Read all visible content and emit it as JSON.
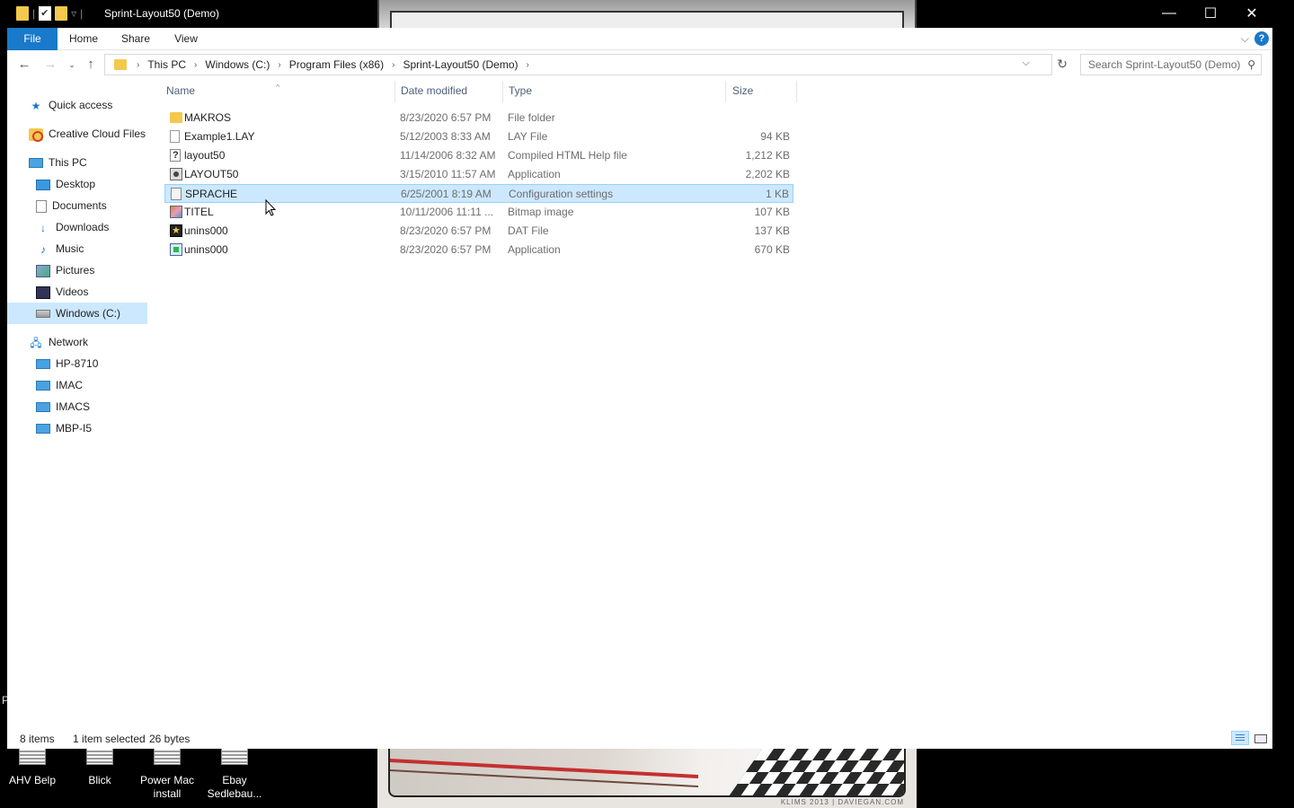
{
  "window": {
    "title": "Sprint-Layout50 (Demo)",
    "minimize": "—",
    "maximize": "☐",
    "close": "✕"
  },
  "ribbon": {
    "tabs": [
      "File",
      "Home",
      "Share",
      "View"
    ],
    "help": "?"
  },
  "address": {
    "crumbs": [
      "This PC",
      "Windows (C:)",
      "Program Files (x86)",
      "Sprint-Layout50 (Demo)"
    ],
    "search_placeholder": "Search Sprint-Layout50 (Demo)"
  },
  "sidebar": {
    "items": [
      {
        "label": "Quick access",
        "icon": "star-icon"
      },
      {
        "label": "Creative Cloud Files",
        "icon": "creative-cloud-icon"
      },
      {
        "label": "This PC",
        "icon": "computer-icon"
      },
      {
        "label": "Desktop",
        "icon": "desktop-icon"
      },
      {
        "label": "Documents",
        "icon": "documents-icon"
      },
      {
        "label": "Downloads",
        "icon": "downloads-icon"
      },
      {
        "label": "Music",
        "icon": "music-icon"
      },
      {
        "label": "Pictures",
        "icon": "pictures-icon"
      },
      {
        "label": "Videos",
        "icon": "videos-icon"
      },
      {
        "label": "Windows (C:)",
        "icon": "drive-icon",
        "selected": true
      },
      {
        "label": "Network",
        "icon": "network-icon"
      },
      {
        "label": "HP-8710",
        "icon": "computer-icon"
      },
      {
        "label": "IMAC",
        "icon": "computer-icon"
      },
      {
        "label": "IMACS",
        "icon": "computer-icon"
      },
      {
        "label": "MBP-I5",
        "icon": "computer-icon"
      }
    ]
  },
  "columns": {
    "name": "Name",
    "date": "Date modified",
    "type": "Type",
    "size": "Size"
  },
  "files": [
    {
      "name": "MAKROS",
      "date": "8/23/2020 6:57 PM",
      "type": "File folder",
      "size": "",
      "icon": "folder-icon"
    },
    {
      "name": "Example1.LAY",
      "date": "5/12/2003 8:33 AM",
      "type": "LAY File",
      "size": "94 KB",
      "icon": "file-icon"
    },
    {
      "name": "layout50",
      "date": "11/14/2006 8:32 AM",
      "type": "Compiled HTML Help file",
      "size": "1,212 KB",
      "icon": "help-file-icon"
    },
    {
      "name": "LAYOUT50",
      "date": "3/15/2010 11:57 AM",
      "type": "Application",
      "size": "2,202 KB",
      "icon": "application-icon"
    },
    {
      "name": "SPRACHE",
      "date": "6/25/2001 8:19 AM",
      "type": "Configuration settings",
      "size": "1 KB",
      "icon": "config-file-icon",
      "selected": true
    },
    {
      "name": "TITEL",
      "date": "10/11/2006 11:11 ...",
      "type": "Bitmap image",
      "size": "107 KB",
      "icon": "bitmap-icon"
    },
    {
      "name": "unins000",
      "date": "8/23/2020 6:57 PM",
      "type": "DAT File",
      "size": "137 KB",
      "icon": "dat-file-icon"
    },
    {
      "name": "unins000",
      "date": "8/23/2020 6:57 PM",
      "type": "Application",
      "size": "670 KB",
      "icon": "setup-icon"
    }
  ],
  "status": {
    "count": "8 items",
    "selected": "1 item selected",
    "bytes": "26 bytes"
  },
  "desktop": {
    "icons": [
      "AHV Belp",
      "Blick",
      "Power Mac install",
      "Ebay Sedlebau..."
    ],
    "credit": "KLIMS 2013 | DAVIEGAN.COM",
    "edge_letter": "P"
  }
}
